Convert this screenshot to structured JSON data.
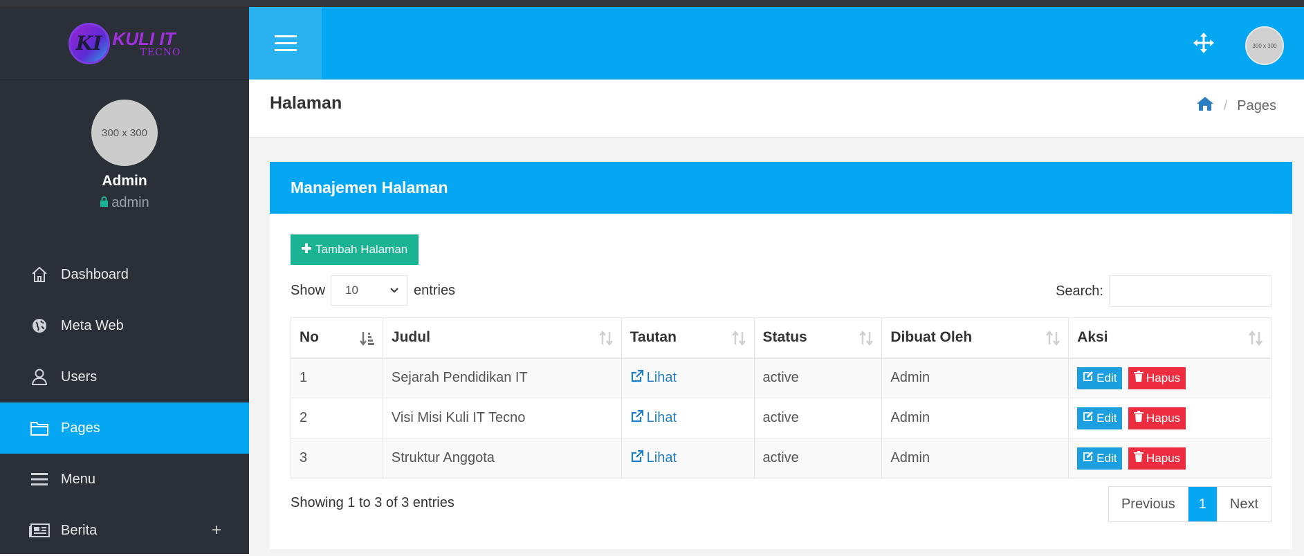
{
  "sidebar": {
    "logo": {
      "mark": "KI",
      "main": "KULI IT",
      "sub": "TECNO"
    },
    "profile": {
      "avatar_text": "300 x 300",
      "name": "Admin",
      "role": "admin"
    },
    "items": [
      {
        "label": "Dashboard",
        "icon": "home-icon",
        "active": false
      },
      {
        "label": "Meta Web",
        "icon": "globe-icon",
        "active": false
      },
      {
        "label": "Users",
        "icon": "user-icon",
        "active": false
      },
      {
        "label": "Pages",
        "icon": "folder-icon",
        "active": true
      },
      {
        "label": "Menu",
        "icon": "menu-icon",
        "active": false
      },
      {
        "label": "Berita",
        "icon": "newspaper-icon",
        "active": false,
        "expand": "+"
      }
    ]
  },
  "header": {
    "avatar_text": "300 x 300"
  },
  "page": {
    "title": "Halaman",
    "breadcrumb": {
      "current": "Pages"
    }
  },
  "card": {
    "title": "Manajemen Halaman",
    "add_button": "Tambah Halaman",
    "show_label": "Show",
    "entries_label": "entries",
    "page_size": "10",
    "search_label": "Search:",
    "search_value": "",
    "columns": [
      "No",
      "Judul",
      "Tautan",
      "Status",
      "Dibuat Oleh",
      "Aksi"
    ],
    "rows": [
      {
        "no": "1",
        "judul": "Sejarah Pendidikan IT",
        "tautan": "Lihat",
        "status": "active",
        "dibuat_oleh": "Admin"
      },
      {
        "no": "2",
        "judul": "Visi Misi Kuli IT Tecno",
        "tautan": "Lihat",
        "status": "active",
        "dibuat_oleh": "Admin"
      },
      {
        "no": "3",
        "judul": "Struktur Anggota",
        "tautan": "Lihat",
        "status": "active",
        "dibuat_oleh": "Admin"
      }
    ],
    "edit_label": "Edit",
    "delete_label": "Hapus",
    "info": "Showing 1 to 3 of 3 entries",
    "pagination": {
      "previous": "Previous",
      "current": "1",
      "next": "Next"
    }
  },
  "colors": {
    "primary": "#05a7f2",
    "sidebar": "#2b3038",
    "success": "#1ab394",
    "danger": "#ed2d3f",
    "link": "#1f7fc6"
  }
}
